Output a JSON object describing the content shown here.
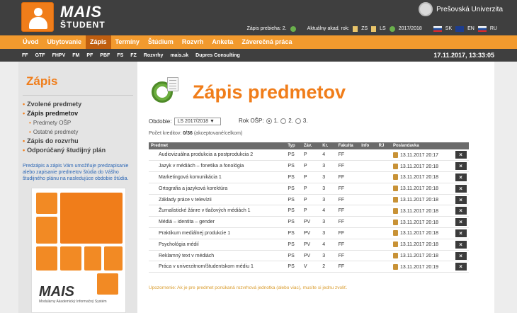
{
  "header": {
    "brand": "MAIS",
    "brand_sub": "ŠTUDENT",
    "university": "Prešovská Univerzita",
    "status": {
      "enrollment_label": "Zápis prebieha: 2.",
      "academic_year_label": "Aktuálny akad. rok:",
      "zs": "ZS",
      "ls": "LS",
      "year": "2017/2018",
      "langs": [
        "SK",
        "EN",
        "RU"
      ]
    }
  },
  "mainnav": [
    "Úvod",
    "Ubytovanie",
    "Zápis",
    "Termíny",
    "Štúdium",
    "Rozvrh",
    "Anketa",
    "Záverečná práca"
  ],
  "subnav": {
    "items": [
      "FF",
      "GTF",
      "FHPV",
      "FM",
      "PF",
      "PBF",
      "FS",
      "FZ",
      "Rozvrhy",
      "mais.sk",
      "Dupres Consulting"
    ],
    "datetime": "17.11.2017, 13:33:05"
  },
  "sidebar": {
    "title": "Zápis",
    "items": [
      {
        "label": "Zvolené predmety",
        "level": 1
      },
      {
        "label": "Zápis predmetov",
        "level": 1
      },
      {
        "label": "Predmety OŠP",
        "level": 2
      },
      {
        "label": "Ostatné predmety",
        "level": 2
      },
      {
        "label": "Zápis do rozvrhu",
        "level": 1
      },
      {
        "label": "Odporúčaný študijný plán",
        "level": 1
      }
    ],
    "note": "Predzápis a zápis Vám umožňuje predzapisanie alebo zapisanie predmetov štúdia do Vášho študijného plánu na nasledujúce obdobie štúdia.",
    "poster_brand": "MAIS",
    "poster_sub": "Modulárny Akademický Informačný Systém"
  },
  "main": {
    "title": "Zápis predmetov",
    "obdobie_label": "Obdobie:",
    "obdobie_value": "LS 2017/2018",
    "rok_label": "Rok OŠP:",
    "rok_options": [
      "1.",
      "2.",
      "3."
    ],
    "rok_selected": "1.",
    "credits_label": "Počet kreditov:",
    "credits_value": "0/36",
    "credits_note": "(akceptované/celkom)",
    "columns": [
      "Predmet",
      "Typ",
      "Záv.",
      "Kr.",
      "Fakulta",
      "Info",
      "RJ",
      "Poslandavka",
      ""
    ],
    "rows": [
      {
        "name": "Audiovizuálna produkcia a postprodukcia 2",
        "typ": "PS",
        "zav": "P",
        "kr": "4",
        "fak": "FF",
        "date": "13.11.2017 20:17"
      },
      {
        "name": "Jazyk v médiách – fonetika a fonológia",
        "typ": "PS",
        "zav": "P",
        "kr": "3",
        "fak": "FF",
        "date": "13.11.2017 20:18"
      },
      {
        "name": "Marketingová komunikácia 1",
        "typ": "PS",
        "zav": "P",
        "kr": "3",
        "fak": "FF",
        "date": "13.11.2017 20:18"
      },
      {
        "name": "Ortografia a jazyková korektúra",
        "typ": "PS",
        "zav": "P",
        "kr": "3",
        "fak": "FF",
        "date": "13.11.2017 20:18"
      },
      {
        "name": "Základy práce v televízii",
        "typ": "PS",
        "zav": "P",
        "kr": "3",
        "fak": "FF",
        "date": "13.11.2017 20:18"
      },
      {
        "name": "Žurnalistické žánre v tlačových médiách 1",
        "typ": "PS",
        "zav": "P",
        "kr": "4",
        "fak": "FF",
        "date": "13.11.2017 20:18"
      },
      {
        "name": "Médiá – identita – gender",
        "typ": "PS",
        "zav": "PV",
        "kr": "3",
        "fak": "FF",
        "date": "13.11.2017 20:18"
      },
      {
        "name": "Praktikum mediálnej produkcie 1",
        "typ": "PS",
        "zav": "PV",
        "kr": "3",
        "fak": "FF",
        "date": "13.11.2017 20:18"
      },
      {
        "name": "Psychológia médií",
        "typ": "PS",
        "zav": "PV",
        "kr": "4",
        "fak": "FF",
        "date": "13.11.2017 20:18"
      },
      {
        "name": "Reklamný text v médiách",
        "typ": "PS",
        "zav": "PV",
        "kr": "3",
        "fak": "FF",
        "date": "13.11.2017 20:18"
      },
      {
        "name": "Práca v univerzitnom/študentskom médiu 1",
        "typ": "PS",
        "zav": "V",
        "kr": "2",
        "fak": "FF",
        "date": "13.11.2017 20:19"
      }
    ],
    "warning": "Upozornenie: Ak je pre predmet ponúkaná rozvrhová jednotka (alebo viac), musíte si jednu zvoliť."
  }
}
